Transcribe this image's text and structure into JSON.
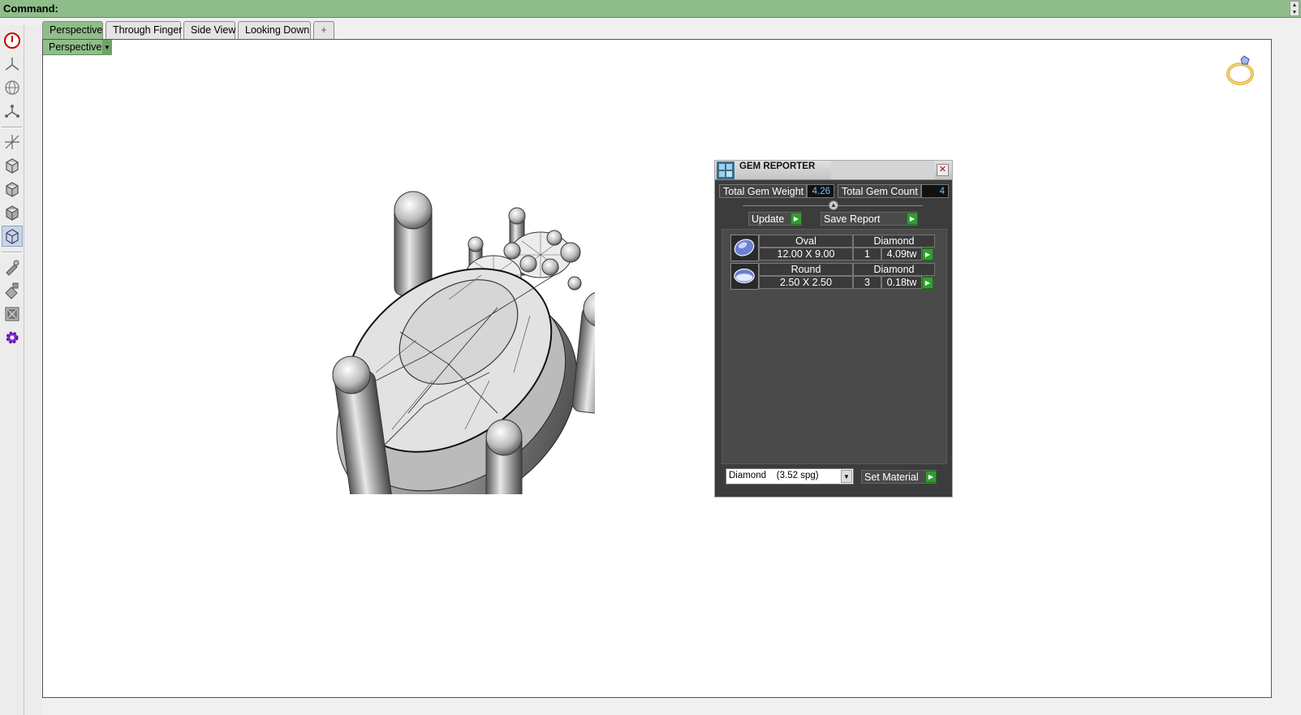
{
  "command_bar": {
    "label": "Command:"
  },
  "toolbar": {
    "buttons": [
      "power-icon",
      "three-axis-icon",
      "globe-icon",
      "nodes-icon",
      "move-axis-icon",
      "cube-icon-1",
      "cube-icon-2",
      "cube-icon-3",
      "cube-icon-4",
      "brush-icon",
      "paint-icon",
      "frame-icon",
      "gear-icon"
    ]
  },
  "tabs": [
    {
      "label": "Perspective"
    },
    {
      "label": "Through Finger"
    },
    {
      "label": "Side View"
    },
    {
      "label": "Looking Down"
    },
    {
      "label": "+"
    }
  ],
  "viewport": {
    "label": "Perspective"
  },
  "gem_reporter": {
    "title": "GEM REPORTER",
    "total_weight_label": "Total Gem Weight",
    "total_weight_value": "4.26",
    "total_count_label": "Total Gem Count",
    "total_count_value": "4",
    "update_label": "Update",
    "save_report_label": "Save Report",
    "rows": [
      {
        "shape": "Oval",
        "material": "Diamond",
        "size": "12.00 X 9.00",
        "count": "1",
        "weight": "4.09tw"
      },
      {
        "shape": "Round",
        "material": "Diamond",
        "size": "2.50 X 2.50",
        "count": "3",
        "weight": "0.18tw"
      }
    ],
    "material_select": "Diamond    (3.52 spg)",
    "set_material_label": "Set Material"
  },
  "colors": {
    "accent_green": "#8fbe8a",
    "dialog_bg": "#3c3c3c",
    "value_blue": "#6cc4ff",
    "arrow_green": "#2f9e2f"
  }
}
